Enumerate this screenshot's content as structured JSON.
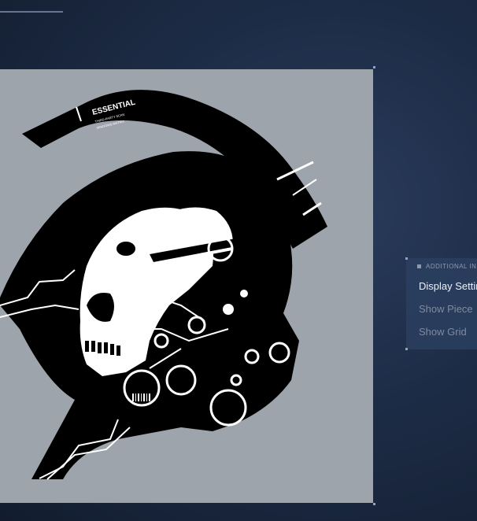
{
  "logo": {
    "label_title": "ESSENTIAL",
    "label_line1": "THIRD-PARTY SCAN",
    "label_line2": "WINDOWS-MATRIX"
  },
  "panel": {
    "header": "ADDITIONAL INFO",
    "items": [
      {
        "label": "Display Settings",
        "active": true
      },
      {
        "label": "Show Piece",
        "active": false
      },
      {
        "label": "Show Grid",
        "active": false
      }
    ]
  },
  "colors": {
    "background": "#1d2c46",
    "frame": "#9ea4ab",
    "ink": "#000000",
    "panel": "#2c4062",
    "text_active": "#eef2f8",
    "text_inactive": "#7f8aa0"
  }
}
